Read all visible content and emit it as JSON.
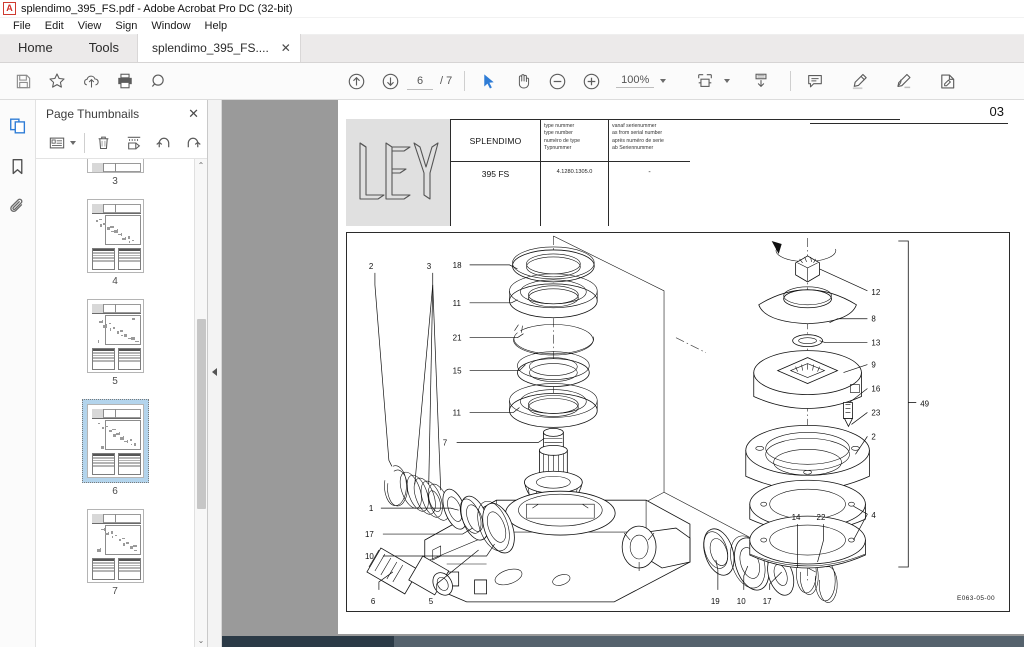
{
  "window": {
    "title": "splendimo_395_FS.pdf - Adobe Acrobat Pro DC (32-bit)",
    "app_icon": "adobe-acrobat-icon"
  },
  "menubar": {
    "items": [
      "File",
      "Edit",
      "View",
      "Sign",
      "Window",
      "Help"
    ]
  },
  "tabs": {
    "home": "Home",
    "tools": "Tools",
    "document": "splendimo_395_FS....",
    "close": "✕"
  },
  "toolbar": {
    "left_tools": [
      {
        "name": "save-icon",
        "title": "Save"
      },
      {
        "name": "star-icon",
        "title": "Add to favorites"
      },
      {
        "name": "cloud-upload-icon",
        "title": "Upload"
      },
      {
        "name": "print-icon",
        "title": "Print"
      },
      {
        "name": "search-icon",
        "title": "Find"
      }
    ],
    "prev_page": "previous-page-icon",
    "next_page": "next-page-icon",
    "page_value": "6",
    "page_total": "/ 7",
    "select_tool": "cursor-arrow-icon",
    "hand_tool": "hand-icon",
    "zoom_out": "zoom-out-icon",
    "zoom_in": "zoom-in-icon",
    "zoom_value": "100%",
    "zoom_caret": "chevron-down-icon",
    "fit_width": "fit-page-icon",
    "fit_caret": "chevron-down-icon",
    "scroll_mode": "page-scroll-icon",
    "right_tools": [
      {
        "name": "comment-icon",
        "title": "Add comment"
      },
      {
        "name": "highlight-icon",
        "title": "Highlight text"
      },
      {
        "name": "signature-icon",
        "title": "Sign"
      },
      {
        "name": "stamp-icon",
        "title": "Stamp"
      }
    ]
  },
  "rail": {
    "items": [
      {
        "name": "page-thumbnails-icon",
        "label": "Page Thumbnails",
        "active": true
      },
      {
        "name": "bookmarks-icon",
        "label": "Bookmarks",
        "active": false
      },
      {
        "name": "attachments-icon",
        "label": "Attachments",
        "active": false
      }
    ]
  },
  "thumbnail_panel": {
    "title": "Page Thumbnails",
    "close": "✕",
    "tools": [
      {
        "name": "thumbnail-size-icon",
        "label": "Thumbnail size"
      },
      {
        "name": "chevron-down-icon",
        "label": "Options"
      },
      {
        "name": "delete-pages-icon",
        "label": "Delete pages"
      },
      {
        "name": "extract-pages-icon",
        "label": "Extract pages"
      },
      {
        "name": "rotate-left-icon",
        "label": "Rotate counterclockwise"
      },
      {
        "name": "rotate-right-icon",
        "label": "Rotate clockwise"
      }
    ],
    "pages": [
      {
        "number": "3",
        "selected": false,
        "partial": true
      },
      {
        "number": "4",
        "selected": false,
        "partial": false
      },
      {
        "number": "5",
        "selected": false,
        "partial": false
      },
      {
        "number": "6",
        "selected": true,
        "partial": false
      },
      {
        "number": "7",
        "selected": false,
        "partial": false
      }
    ],
    "scroll_up": "⌃",
    "scroll_down": "⌄"
  },
  "document": {
    "page_label": "03",
    "logo_text": "LELY",
    "header": {
      "brand": "SPLENDIMO",
      "col_type": [
        "type nummer",
        "type number",
        "numéro de type",
        "Typnummer"
      ],
      "col_serial": [
        "vanaf serienummer",
        "as from serial number",
        "après numéro de serie",
        "ab Seriennummer"
      ],
      "model": "395 FS",
      "type_number": "4.1280.1305.0",
      "serial_number": "-"
    },
    "drawing_code": "E063-05-00",
    "callouts_left_column": [
      "18",
      "11",
      "21",
      "15",
      "11",
      "7"
    ],
    "callouts_lower_left": [
      "2",
      "3",
      "1",
      "17",
      "10",
      "6",
      "5"
    ],
    "callouts_lower_right": [
      "19",
      "10",
      "17",
      "14",
      "22"
    ],
    "callouts_right_column": [
      "12",
      "8",
      "13",
      "9",
      "16",
      "23",
      "2",
      "4"
    ],
    "bracket_label": "49"
  },
  "colors": {
    "accent": "#2e7cd6",
    "toolbar_bg": "#fbfbfb",
    "tabstrip_bg": "#eceaea",
    "doc_bg": "#9a9a9a",
    "selection": "#b3d4ec",
    "scrollbar_h": "#2b3a46"
  }
}
